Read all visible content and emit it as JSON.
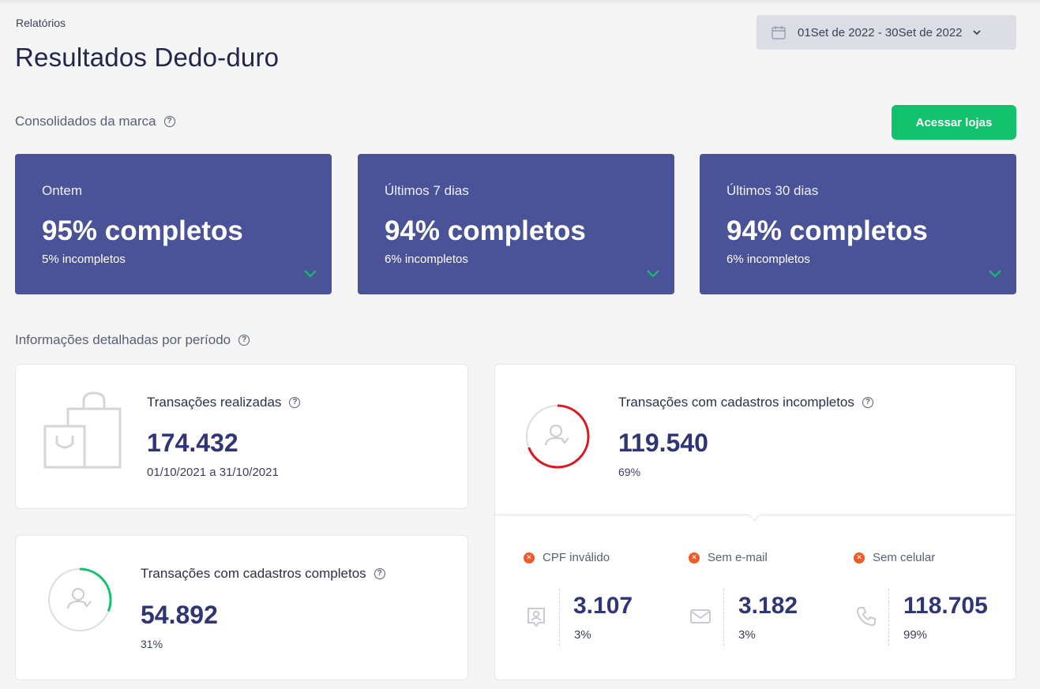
{
  "breadcrumb": "Relatórios",
  "page_title": "Resultados Dedo-duro",
  "date_range": "01Set de 2022 - 30Set de 2022",
  "consolidated": {
    "title": "Consolidados da marca",
    "button": "Acessar lojas",
    "cards": [
      {
        "period": "Ontem",
        "main": "95% completos",
        "sub": "5% incompletos"
      },
      {
        "period": "Últimos 7 dias",
        "main": "94% completos",
        "sub": "6% incompletos"
      },
      {
        "period": "Últimos 30 dias",
        "main": "94% completos",
        "sub": "6% incompletos"
      }
    ]
  },
  "detailed": {
    "title": "Informações detalhadas por período",
    "transactions": {
      "label": "Transações realizadas",
      "value": "174.432",
      "range": "01/10/2021 a 31/10/2021"
    },
    "complete": {
      "label": "Transações com cadastros completos",
      "value": "54.892",
      "pct": "31%",
      "ratio": 0.31
    },
    "incomplete": {
      "label": "Transações com cadastros incompletos",
      "value": "119.540",
      "pct": "69%",
      "ratio": 0.69,
      "issues": [
        {
          "label": "CPF inválido",
          "value": "3.107",
          "pct": "3%",
          "icon": "id-card-icon"
        },
        {
          "label": "Sem e-mail",
          "value": "3.182",
          "pct": "3%",
          "icon": "mail-icon"
        },
        {
          "label": "Sem celular",
          "value": "118.705",
          "pct": "99%",
          "icon": "phone-icon"
        }
      ]
    }
  },
  "colors": {
    "kpi_bg": "#4a5298",
    "button_green": "#11c16c",
    "ring_green": "#11c16c",
    "ring_red": "#e0161e",
    "error_orange": "#f05a28",
    "number_blue": "#2f3575"
  }
}
